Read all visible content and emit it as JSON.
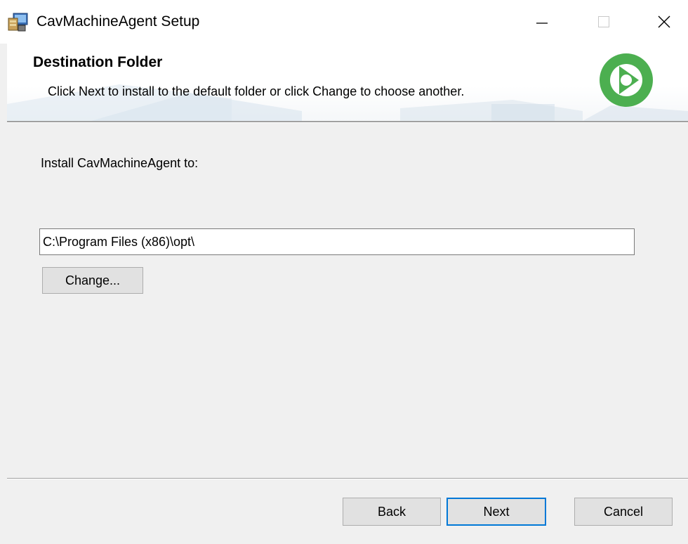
{
  "window": {
    "title": "CavMachineAgent Setup",
    "icon": "installer-app-icon",
    "controls": {
      "minimize": "minimize-icon",
      "maximize": "maximize-icon",
      "close": "close-icon"
    }
  },
  "header": {
    "title": "Destination Folder",
    "subtitle": "Click Next to install to the default folder or click Change to choose another.",
    "logo": "green-circle-arrow-logo",
    "logo_color": "#4caf50"
  },
  "body": {
    "install_label": "Install CavMachineAgent to:",
    "path_value": "C:\\Program Files (x86)\\opt\\",
    "change_label": "Change..."
  },
  "footer": {
    "back_label": "Back",
    "next_label": "Next",
    "cancel_label": "Cancel"
  },
  "colors": {
    "focus_border": "#0078d7",
    "button_face": "#e1e1e1",
    "window_bg": "#f0f0f0"
  }
}
